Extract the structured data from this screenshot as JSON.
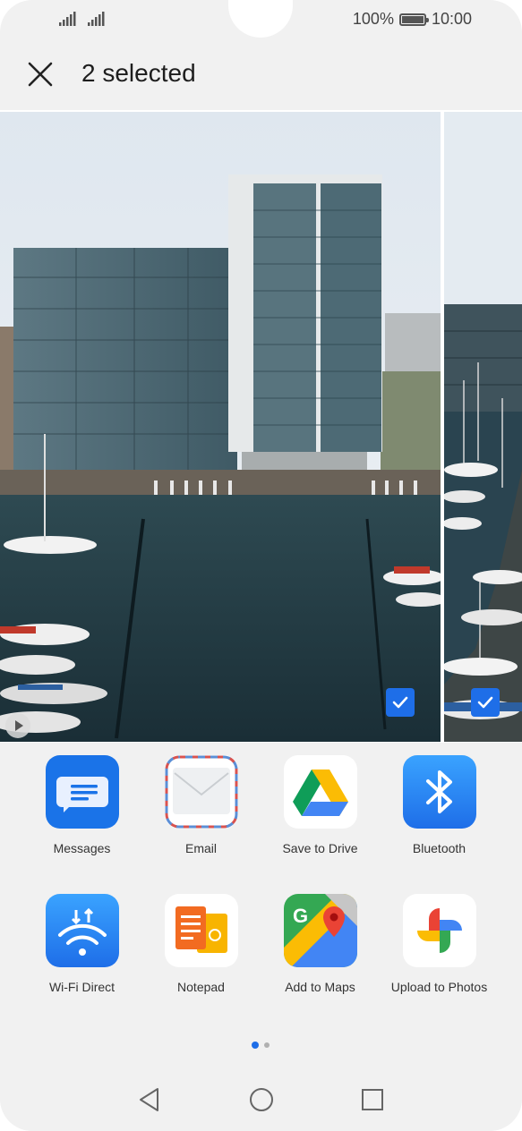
{
  "status_bar": {
    "battery_percent": "100%",
    "battery_level": 1.0,
    "time": "10:00"
  },
  "header": {
    "title": "2 selected",
    "close_icon": "close-icon"
  },
  "gallery": {
    "items": [
      {
        "type": "video",
        "selected": true
      },
      {
        "type": "photo",
        "selected": true
      }
    ]
  },
  "share_targets": [
    {
      "label": "Messages",
      "icon": "messages-icon",
      "color": "#1a73e8"
    },
    {
      "label": "Email",
      "icon": "email-icon",
      "color": "#ffffff"
    },
    {
      "label": "Save to Drive",
      "icon": "google-drive-icon",
      "color": "#ffffff"
    },
    {
      "label": "Bluetooth",
      "icon": "bluetooth-icon",
      "color": "#1e88f5"
    },
    {
      "label": "Wi-Fi Direct",
      "icon": "wifi-direct-icon",
      "color": "#1e88f5"
    },
    {
      "label": "Notepad",
      "icon": "notepad-icon",
      "color": "#ffffff"
    },
    {
      "label": "Add to Maps",
      "icon": "google-maps-icon",
      "color": "#ffffff"
    },
    {
      "label": "Upload to Photos",
      "icon": "google-photos-icon",
      "color": "#ffffff"
    }
  ],
  "pagination": {
    "current": 1,
    "total": 2
  },
  "nav_bar": {
    "back": "back-icon",
    "home": "home-icon",
    "recents": "recents-icon"
  },
  "colors": {
    "accent": "#1e6ee8",
    "background": "#f1f1f1"
  }
}
